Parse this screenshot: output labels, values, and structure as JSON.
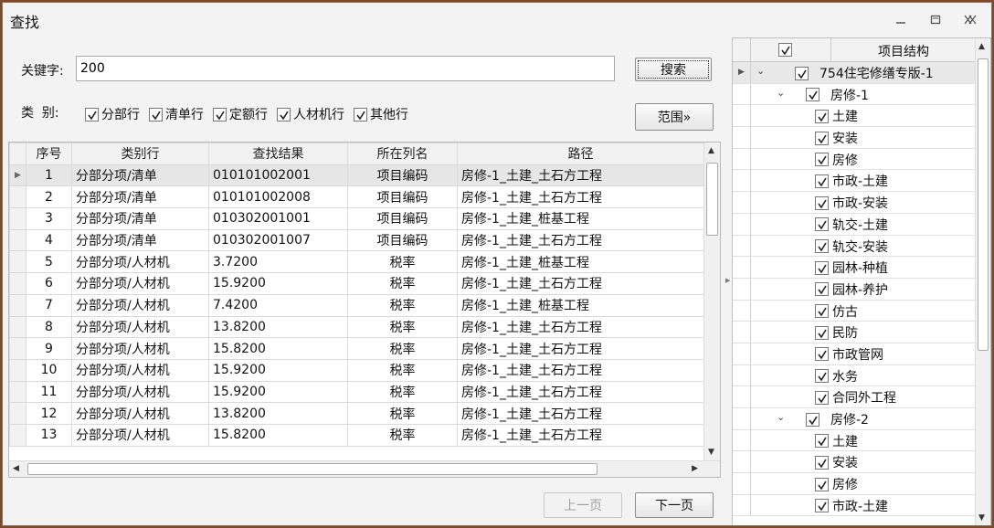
{
  "window": {
    "title": "查找"
  },
  "search": {
    "keyword_label": "关键字:",
    "keyword_value": "200",
    "search_button": "搜索",
    "category_label": "类  别:",
    "range_button": "范围»",
    "categories": [
      {
        "label": "分部行",
        "checked": true
      },
      {
        "label": "清单行",
        "checked": true
      },
      {
        "label": "定额行",
        "checked": true
      },
      {
        "label": "人材机行",
        "checked": true
      },
      {
        "label": "其他行",
        "checked": true
      }
    ]
  },
  "results": {
    "headers": [
      "序号",
      "类别行",
      "查找结果",
      "所在列名",
      "路径"
    ],
    "rows": [
      [
        "1",
        "分部分项/清单",
        "010101002001",
        "项目编码",
        "房修-1_土建_土石方工程"
      ],
      [
        "2",
        "分部分项/清单",
        "010101002008",
        "项目编码",
        "房修-1_土建_土石方工程"
      ],
      [
        "3",
        "分部分项/清单",
        "010302001001",
        "项目编码",
        "房修-1_土建_桩基工程"
      ],
      [
        "4",
        "分部分项/清单",
        "010302001007",
        "项目编码",
        "房修-1_土建_土石方工程"
      ],
      [
        "5",
        "分部分项/人材机",
        "3.7200",
        "税率",
        "房修-1_土建_桩基工程"
      ],
      [
        "6",
        "分部分项/人材机",
        "15.9200",
        "税率",
        "房修-1_土建_土石方工程"
      ],
      [
        "7",
        "分部分项/人材机",
        "7.4200",
        "税率",
        "房修-1_土建_桩基工程"
      ],
      [
        "8",
        "分部分项/人材机",
        "13.8200",
        "税率",
        "房修-1_土建_土石方工程"
      ],
      [
        "9",
        "分部分项/人材机",
        "15.8200",
        "税率",
        "房修-1_土建_土石方工程"
      ],
      [
        "10",
        "分部分项/人材机",
        "15.9200",
        "税率",
        "房修-1_土建_土石方工程"
      ],
      [
        "11",
        "分部分项/人材机",
        "15.9200",
        "税率",
        "房修-1_土建_土石方工程"
      ],
      [
        "12",
        "分部分项/人材机",
        "13.8200",
        "税率",
        "房修-1_土建_土石方工程"
      ],
      [
        "13",
        "分部分项/人材机",
        "15.8200",
        "税率",
        "房修-1_土建_土石方工程"
      ]
    ]
  },
  "pager": {
    "prev": "上一页",
    "next": "下一页"
  },
  "tree": {
    "header": "项目结构",
    "root": "754住宅修缮专版-1",
    "groups": [
      {
        "name": "房修-1",
        "items": [
          "土建",
          "安装",
          "房修",
          "市政-土建",
          "市政-安装",
          "轨交-土建",
          "轨交-安装",
          "园林-种植",
          "园林-养护",
          "仿古",
          "民防",
          "市政管网",
          "水务",
          "合同外工程"
        ]
      },
      {
        "name": "房修-2",
        "items": [
          "土建",
          "安装",
          "房修",
          "市政-土建"
        ]
      }
    ]
  }
}
